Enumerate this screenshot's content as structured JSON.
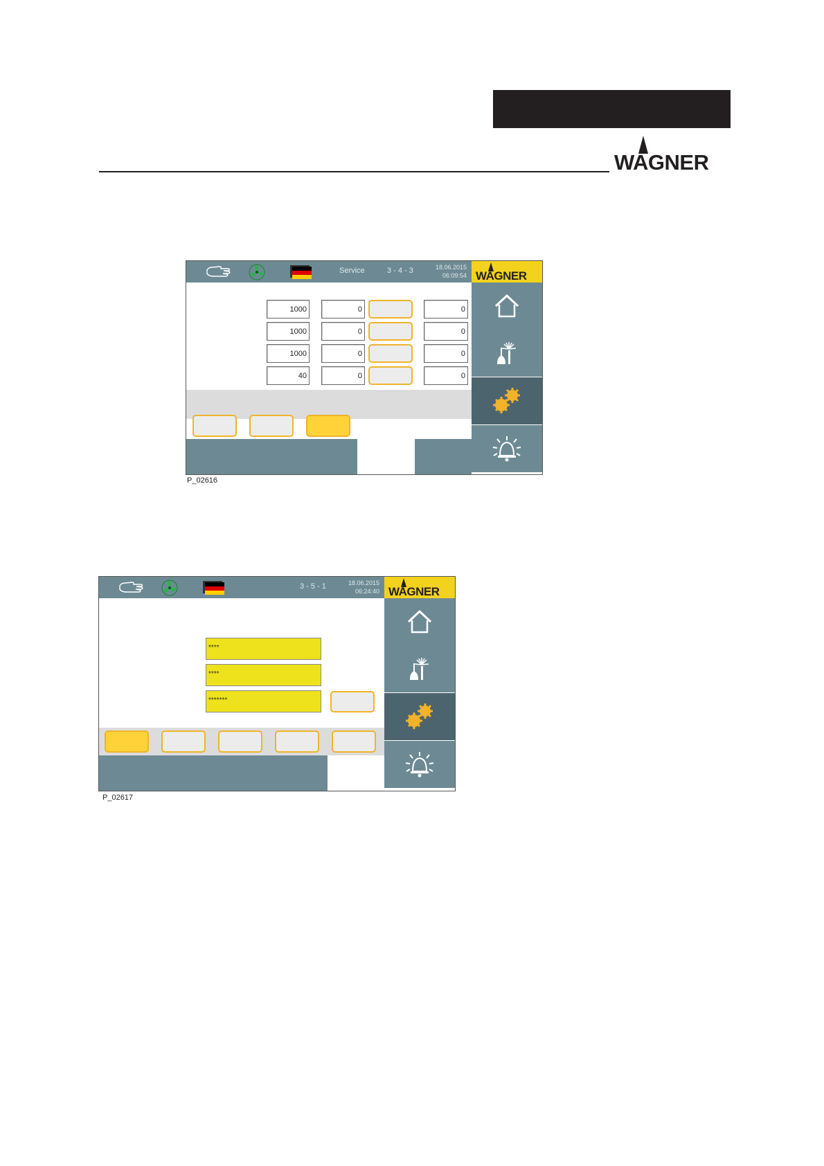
{
  "page": {
    "brand": "WAGNER",
    "header_bar_color": "#231f20"
  },
  "colors": {
    "teal": "#6d8a94",
    "dark_teal": "#4c646d",
    "yellow": "#f3d21d",
    "orange": "#f0b32a",
    "field_yellow": "#eee21d"
  },
  "screen1": {
    "caption": "P_02616",
    "topbar": {
      "title": "Service",
      "screen_id": "3 - 4 - 3",
      "date": "18.06.2015",
      "time": "06:09:54"
    },
    "logo": "WAGNER",
    "rows": [
      {
        "value_a": "1000",
        "value_b": "0",
        "value_c": "0"
      },
      {
        "value_a": "1000",
        "value_b": "0",
        "value_c": "0"
      },
      {
        "value_a": "1000",
        "value_b": "0",
        "value_c": "0"
      },
      {
        "value_a": "40",
        "value_b": "0",
        "value_c": "0"
      }
    ],
    "nav_icons": [
      "home-icon",
      "spray-gun-icon",
      "gears-icon",
      "alarm-bell-icon"
    ],
    "active_nav": "gears-icon"
  },
  "screen2": {
    "caption": "P_02617",
    "topbar": {
      "screen_id": "3 - 5 - 1",
      "date": "18.06.2015",
      "time": "06:24:40"
    },
    "logo": "WAGNER",
    "password_fields": [
      "****",
      "****",
      "*******"
    ],
    "nav_icons": [
      "home-icon",
      "spray-gun-icon",
      "gears-icon",
      "alarm-bell-icon"
    ],
    "active_nav": "gears-icon"
  }
}
